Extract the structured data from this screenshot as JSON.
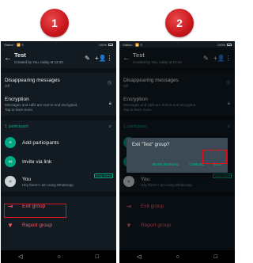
{
  "steps": {
    "one": "1",
    "two": "2"
  },
  "status": {
    "left": "Station · 📶 ⊙",
    "battery": "100%"
  },
  "chat": {
    "title": "Test",
    "subtitle": "Created by You, today at 12:40"
  },
  "disappearing": {
    "title": "Disappearing messages",
    "value": "Off"
  },
  "encryption": {
    "title": "Encryption",
    "line1": "Messages and calls are end-to-end encrypted.",
    "line2": "Tap to learn more."
  },
  "participants": {
    "header": "1 participant",
    "add": "Add participants",
    "invite": "Invite via link",
    "you_name": "You",
    "you_status": "Hey there! I am using WhatsApp.",
    "admin_chip": "Group Admin"
  },
  "actions": {
    "exit": "Exit group",
    "report": "Report group"
  },
  "dialog": {
    "message": "Exit \"Test\" group?",
    "mute": "MUTE INSTEAD",
    "cancel": "CANCEL",
    "exit": "EXIT"
  },
  "icons": {
    "back": "arrow-left",
    "edit": "pencil",
    "add_person": "person-add",
    "more": "dots-vertical",
    "timer": "timer",
    "lock": "lock",
    "search": "magnifier",
    "link": "link",
    "exit": "logout",
    "thumb_down": "thumb-down",
    "nav": [
      "back-triangle",
      "home-circle",
      "recent-square"
    ]
  },
  "colors": {
    "accent": "#00a884",
    "danger": "#f15c6d",
    "highlight": "#e11219",
    "background": "#121b22"
  }
}
